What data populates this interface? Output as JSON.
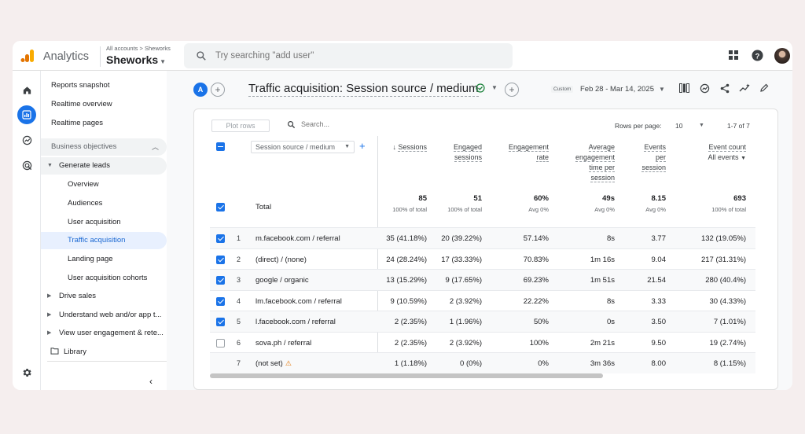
{
  "header": {
    "app_title": "Analytics",
    "breadcrumb": "All accounts > Sheworks",
    "account": "Sheworks",
    "search_placeholder": "Try searching \"add user\""
  },
  "nav": {
    "reports_snapshot": "Reports snapshot",
    "realtime_overview": "Realtime overview",
    "realtime_pages": "Realtime pages",
    "section_business": "Business objectives",
    "group_generate_leads": "Generate leads",
    "sub_overview": "Overview",
    "sub_audiences": "Audiences",
    "sub_user_acquisition": "User acquisition",
    "sub_traffic_acquisition": "Traffic acquisition",
    "sub_landing_page": "Landing page",
    "sub_user_acq_cohorts": "User acquisition cohorts",
    "group_drive_sales": "Drive sales",
    "group_understand": "Understand web and/or app t...",
    "group_view_engagement": "View user engagement & rete...",
    "library": "Library"
  },
  "report": {
    "chip_letter": "A",
    "title": "Traffic acquisition: Session source / medium",
    "date_badge": "Custom",
    "date_range": "Feb 28 - Mar 14, 2025"
  },
  "table_controls": {
    "plot_rows": "Plot rows",
    "search_placeholder": "Search...",
    "rows_per_page_label": "Rows per page:",
    "rows_per_page_value": "10",
    "pager": "1-7 of 7",
    "dimension": "Session source / medium"
  },
  "columns": {
    "sessions": "Sessions",
    "engaged_sessions_1": "Engaged",
    "engaged_sessions_2": "sessions",
    "engagement_rate_1": "Engagement",
    "engagement_rate_2": "rate",
    "avg_time_1": "Average",
    "avg_time_2": "engagement",
    "avg_time_3": "time per",
    "avg_time_4": "session",
    "events_1": "Events",
    "events_2": "per",
    "events_3": "session",
    "event_count": "Event count",
    "event_count_sub": "All events"
  },
  "total": {
    "label": "Total",
    "sessions": "85",
    "sessions_sub": "100% of total",
    "engaged": "51",
    "engaged_sub": "100% of total",
    "rate": "60%",
    "rate_sub": "Avg 0%",
    "avg_time": "49s",
    "avg_time_sub": "Avg 0%",
    "events_per": "8.15",
    "events_per_sub": "Avg 0%",
    "event_count": "693",
    "event_count_sub": "100% of total"
  },
  "rows": [
    {
      "n": "1",
      "dim": "m.facebook.com / referral",
      "sessions": "35 (41.18%)",
      "engaged": "20 (39.22%)",
      "rate": "57.14%",
      "avg_time": "8s",
      "events_per": "3.77",
      "event_count": "132 (19.05%)"
    },
    {
      "n": "2",
      "dim": "(direct) / (none)",
      "sessions": "24 (28.24%)",
      "engaged": "17 (33.33%)",
      "rate": "70.83%",
      "avg_time": "1m 16s",
      "events_per": "9.04",
      "event_count": "217 (31.31%)"
    },
    {
      "n": "3",
      "dim": "google / organic",
      "sessions": "13 (15.29%)",
      "engaged": "9 (17.65%)",
      "rate": "69.23%",
      "avg_time": "1m 51s",
      "events_per": "21.54",
      "event_count": "280 (40.4%)"
    },
    {
      "n": "4",
      "dim": "lm.facebook.com / referral",
      "sessions": "9 (10.59%)",
      "engaged": "2 (3.92%)",
      "rate": "22.22%",
      "avg_time": "8s",
      "events_per": "3.33",
      "event_count": "30 (4.33%)"
    },
    {
      "n": "5",
      "dim": "l.facebook.com / referral",
      "sessions": "2 (2.35%)",
      "engaged": "1 (1.96%)",
      "rate": "50%",
      "avg_time": "0s",
      "events_per": "3.50",
      "event_count": "7 (1.01%)"
    },
    {
      "n": "6",
      "dim": "sova.ph / referral",
      "sessions": "2 (2.35%)",
      "engaged": "2 (3.92%)",
      "rate": "100%",
      "avg_time": "2m 21s",
      "events_per": "9.50",
      "event_count": "19 (2.74%)"
    },
    {
      "n": "7",
      "dim": "(not set)",
      "sessions": "1 (1.18%)",
      "engaged": "0 (0%)",
      "rate": "0%",
      "avg_time": "3m 36s",
      "events_per": "8.00",
      "event_count": "8 (1.15%)"
    }
  ],
  "colors": {
    "accent": "#1a73e8",
    "logo_orange": "#f9ab00",
    "logo_dark": "#e37400",
    "warning": "#e37400"
  }
}
